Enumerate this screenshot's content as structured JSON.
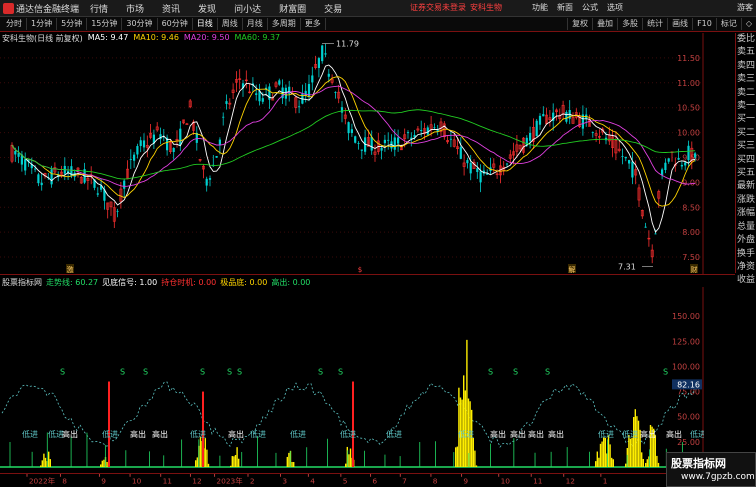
{
  "app": {
    "title": "通达信金融终端",
    "menu": [
      "行情",
      "市场",
      "资讯",
      "发现",
      "问小达",
      "财富圈",
      "交易"
    ],
    "notice": "证券交易未登录",
    "stock_name": "安科生物",
    "right_menu": [
      "功能",
      "新面",
      "公式",
      "选项"
    ],
    "guest": "游客"
  },
  "toolbar": {
    "periods": [
      "分时",
      "1分钟",
      "5分钟",
      "15分钟",
      "30分钟",
      "60分钟",
      "日线",
      "周线",
      "月线",
      "多周期",
      "更多"
    ],
    "active_period": "日线",
    "tools": [
      "复权",
      "叠加",
      "多股",
      "统计",
      "画线",
      "F10",
      "标记",
      "◇"
    ]
  },
  "main_chart": {
    "title": "安科生物(日线 前复权)",
    "ma": [
      {
        "label": "MA5: 9.47",
        "color": "#ffffff"
      },
      {
        "label": "MA10: 9.46",
        "color": "#ffd400"
      },
      {
        "label": "MA20: 9.50",
        "color": "#e040e0"
      },
      {
        "label": "MA60: 9.37",
        "color": "#22cc22"
      }
    ],
    "price_ticks": [
      "11.50",
      "11.00",
      "10.50",
      "10.00",
      "9.50",
      "9.00",
      "8.50",
      "8.00",
      "7.50"
    ],
    "high_label": "11.79",
    "low_label": "7.31",
    "marks": [
      "激",
      "$",
      "解",
      "财"
    ],
    "sidebar": [
      "委比",
      "卖五",
      "卖四",
      "卖三",
      "卖二",
      "卖一",
      "买一",
      "买二",
      "买三",
      "买四",
      "买五",
      "最新",
      "涨跌",
      "涨幅",
      "总量",
      "外盘",
      "换手",
      "净资",
      "收益"
    ]
  },
  "indicator": {
    "name": "股票指标网",
    "params": [
      {
        "label": "走势线: 60.27",
        "color": "#22dd66"
      },
      {
        "label": "见底信号: 1.00",
        "color": "#ffffff"
      },
      {
        "label": "持仓时机: 0.00",
        "color": "#ff3030"
      },
      {
        "label": "极品底: 0.00",
        "color": "#ffd400"
      },
      {
        "label": "高出: 0.00",
        "color": "#22dd66"
      }
    ],
    "ticks": [
      "150.00",
      "125.00",
      "100.00",
      "75.00",
      "50.00",
      "25.00"
    ],
    "current_value": "82.16",
    "signals": [
      "低进",
      "高出",
      "S"
    ]
  },
  "dates": [
    "2022年",
    "8",
    "9",
    "10",
    "11",
    "12",
    "2023年",
    "2",
    "3",
    "4",
    "5",
    "6",
    "7",
    "8",
    "9",
    "10",
    "11",
    "12",
    "1"
  ],
  "watermark": {
    "line1": "股票指标网",
    "line2": "www.7gpzb.com"
  },
  "chart_data": {
    "type": "candlestick+indicator",
    "price_range": [
      7.3,
      11.9
    ],
    "ma_lines": [
      "MA5",
      "MA10",
      "MA20",
      "MA60"
    ],
    "high": 11.79,
    "low": 7.31,
    "indicator_range": [
      0,
      175
    ]
  }
}
